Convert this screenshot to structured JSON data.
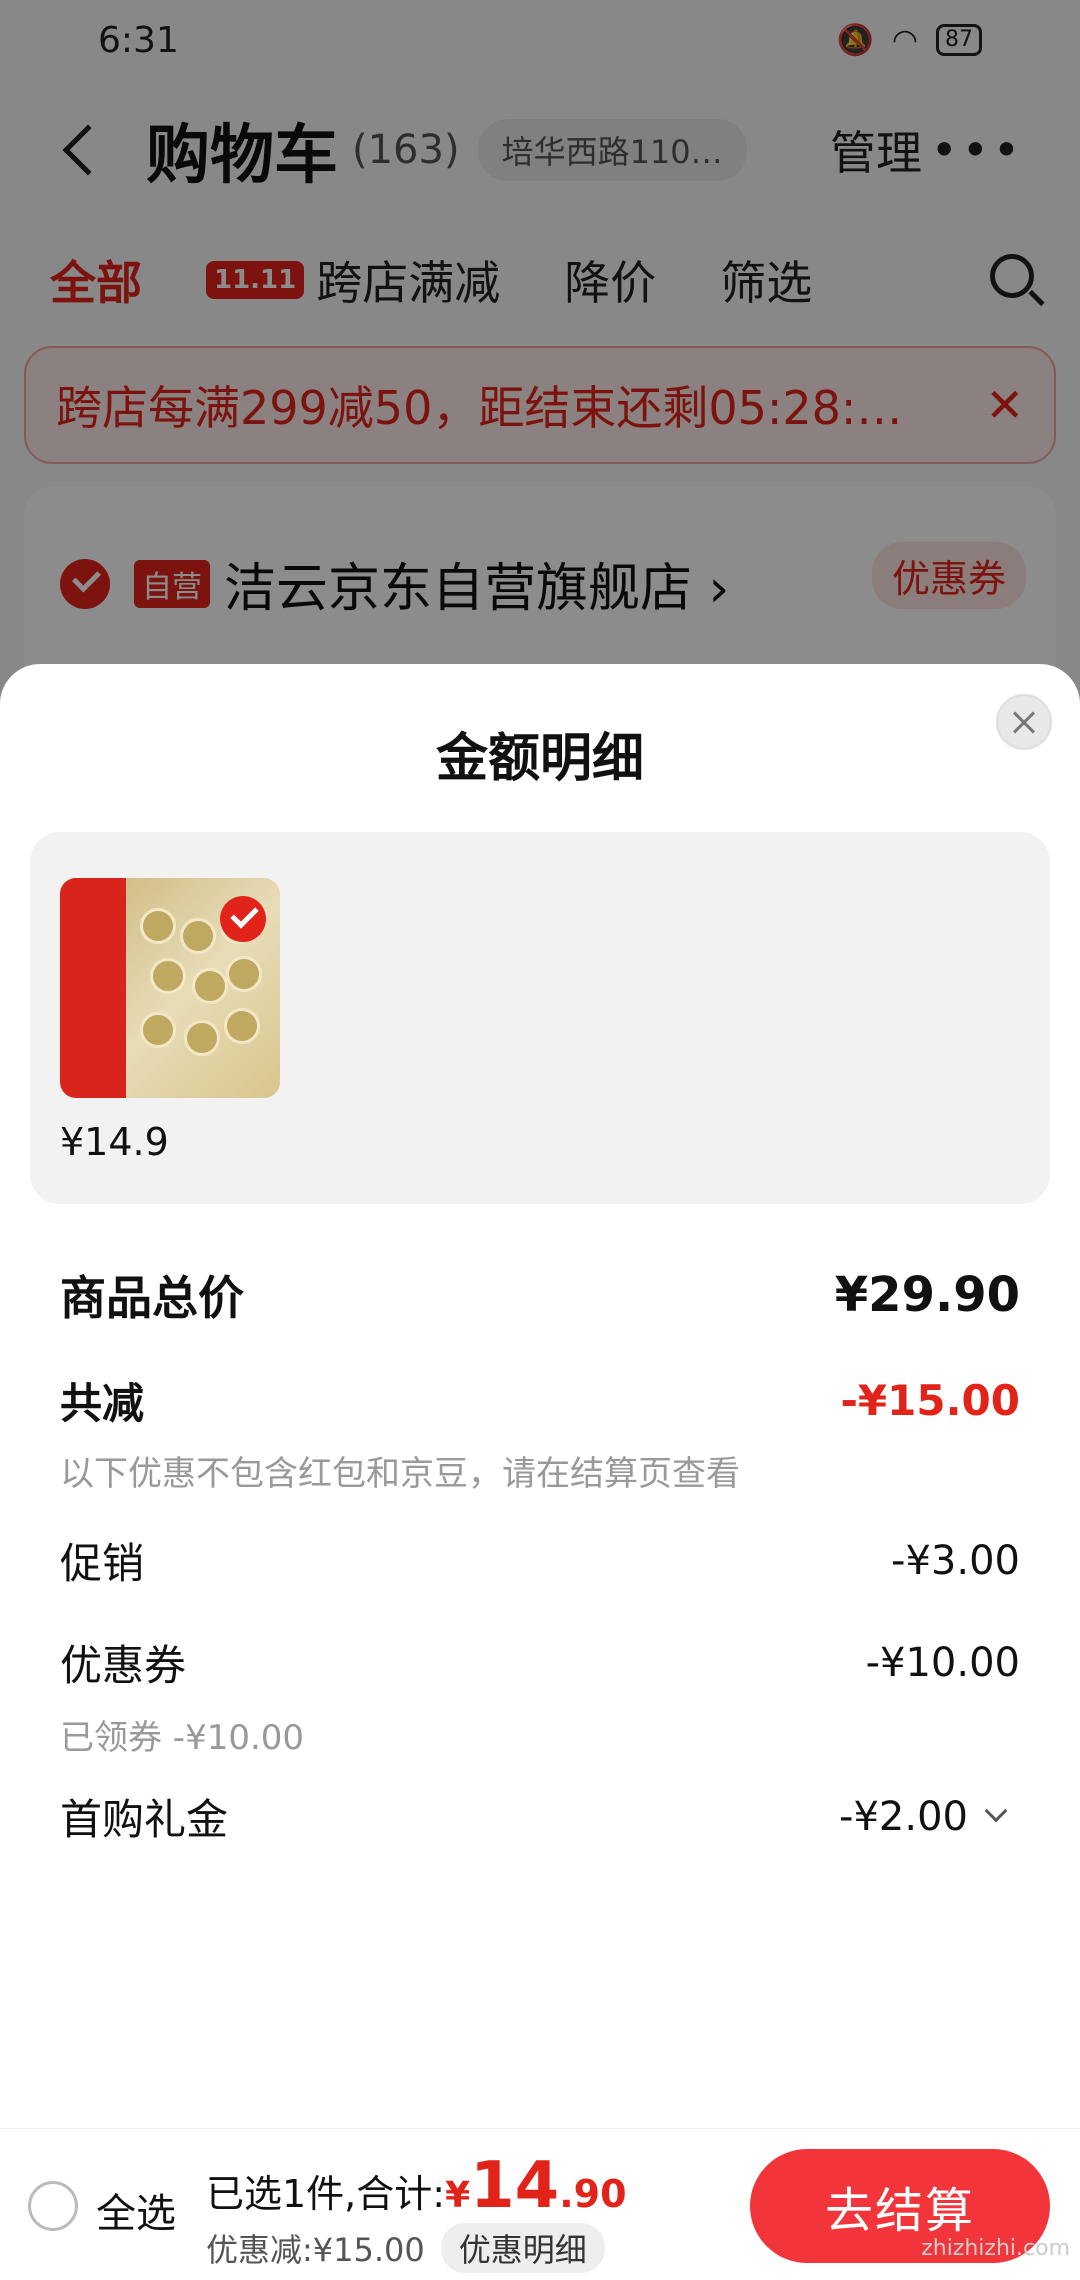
{
  "status_bar": {
    "time": "6:31",
    "battery": "87"
  },
  "nav": {
    "title": "购物车",
    "count": "(163)",
    "address": "培华西路110…",
    "manage_label": "管理"
  },
  "tabs": [
    {
      "label": "全部"
    },
    {
      "badge": "11.11",
      "label": "跨店满减"
    },
    {
      "label": "降价"
    },
    {
      "label": "筛选"
    }
  ],
  "promo": {
    "text": "跨店每满299减50，距结束还剩05:28:…"
  },
  "store": {
    "badge": "自营",
    "name": "洁云京东自营旗舰店 ›",
    "coupon_label": "优惠券"
  },
  "sheet": {
    "title": "金额明细",
    "products": [
      {
        "price": "¥14.9"
      }
    ],
    "total_label": "商品总价",
    "total_value": "¥29.90",
    "reduce_label": "共减",
    "reduce_value": "-¥15.00",
    "reduce_note": "以下优惠不包含红包和京豆，请在结算页查看",
    "items": [
      {
        "label": "促销",
        "value": "-¥3.00"
      },
      {
        "label": "优惠券",
        "value": "-¥10.00",
        "sub": "已领券 -¥10.00"
      },
      {
        "label": "首购礼金",
        "value": "-¥2.00"
      }
    ]
  },
  "bottom_bar": {
    "select_all": "全选",
    "selected_text": "已选1件,合计:",
    "currency": "¥",
    "amount_int": "14",
    "amount_dec": ".90",
    "discount_text": "优惠减:¥15.00",
    "detail_label": "优惠明细",
    "checkout_label": "去结算"
  },
  "watermark": "zhizhizhi.com",
  "colors": {
    "accent": "#e2231a",
    "checkout": "#f2353a"
  }
}
